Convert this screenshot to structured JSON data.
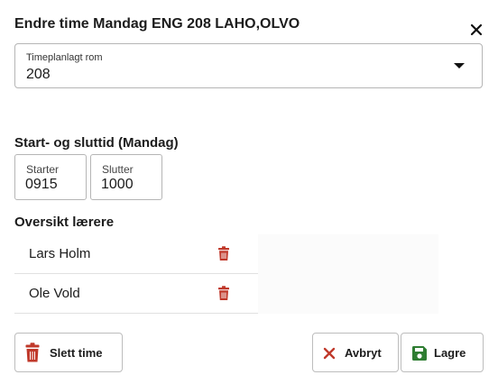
{
  "dialog": {
    "title": "Endre time Mandag ENG 208 LAHO,OLVO"
  },
  "room": {
    "label": "Timeplanlagt rom",
    "value": "208"
  },
  "times": {
    "heading": "Start- og sluttid (Mandag)",
    "start_label": "Starter",
    "start_value": "0915",
    "end_label": "Slutter",
    "end_value": "1000"
  },
  "teachers": {
    "heading": "Oversikt lærere",
    "items": [
      {
        "name": "Lars Holm"
      },
      {
        "name": "Ole Vold"
      }
    ]
  },
  "buttons": {
    "delete": "Slett time",
    "cancel": "Avbryt",
    "save": "Lagre"
  },
  "colors": {
    "danger": "#c0392b",
    "save": "#2e7d32"
  }
}
